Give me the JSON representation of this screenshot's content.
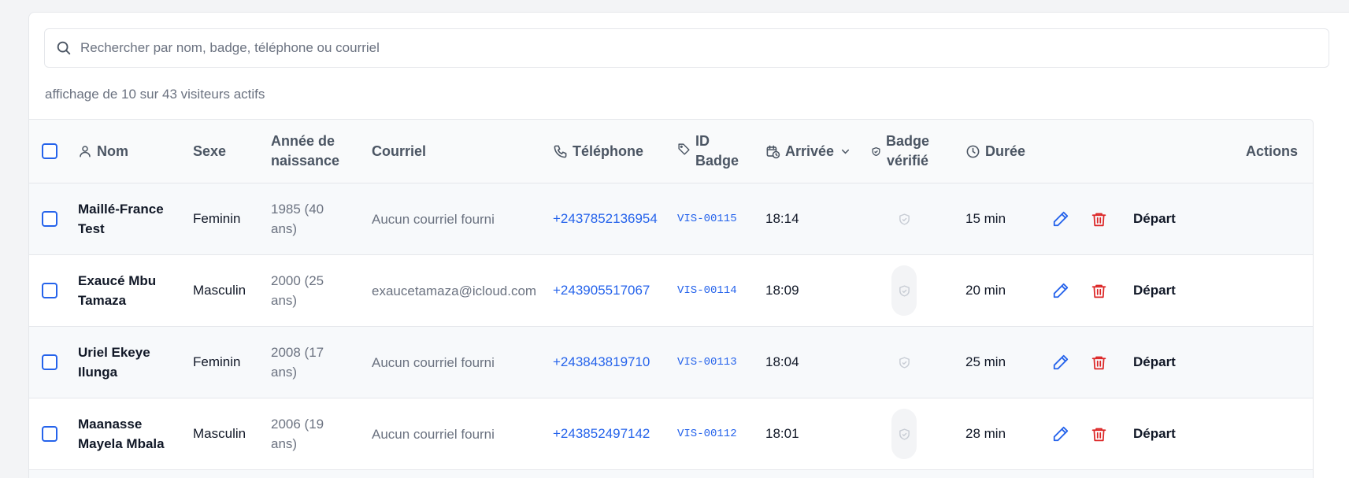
{
  "search": {
    "placeholder": "Rechercher par nom, badge, téléphone ou courriel"
  },
  "summary": "affichage de 10 sur 43 visiteurs actifs",
  "table": {
    "headers": {
      "name": "Nom",
      "sex": "Sexe",
      "birth_line1": "Année de",
      "birth_line2": "naissance",
      "email": "Courriel",
      "phone": "Téléphone",
      "badge_line1": "ID",
      "badge_line2": "Badge",
      "arrival": "Arrivée",
      "verified_line1": "Badge",
      "verified_line2": "vérifié",
      "duration": "Durée",
      "actions": "Actions"
    },
    "rows": [
      {
        "name_line1": "Maillé-France",
        "name_line2": "Test",
        "sex": "Feminin",
        "birth_line1": "1985 (40",
        "birth_line2": "ans)",
        "email": "Aucun courriel fourni",
        "phone": "+2437852136954",
        "badge": "VIS-00115",
        "arrival": "18:14",
        "duration": "15 min",
        "depart": "Départ"
      },
      {
        "name_line1": "Exaucé Mbu",
        "name_line2": "Tamaza",
        "sex": "Masculin",
        "birth_line1": "2000 (25",
        "birth_line2": "ans)",
        "email": "exaucetamaza@icloud.com",
        "phone": "+243905517067",
        "badge": "VIS-00114",
        "arrival": "18:09",
        "duration": "20 min",
        "depart": "Départ"
      },
      {
        "name_line1": "Uriel Ekeye",
        "name_line2": "Ilunga",
        "sex": "Feminin",
        "birth_line1": "2008 (17",
        "birth_line2": "ans)",
        "email": "Aucun courriel fourni",
        "phone": "+243843819710",
        "badge": "VIS-00113",
        "arrival": "18:04",
        "duration": "25 min",
        "depart": "Départ"
      },
      {
        "name_line1": "Maanasse",
        "name_line2": "Mayela Mbala",
        "sex": "Masculin",
        "birth_line1": "2006 (19",
        "birth_line2": "ans)",
        "email": "Aucun courriel fourni",
        "phone": "+243852497142",
        "badge": "VIS-00112",
        "arrival": "18:01",
        "duration": "28 min",
        "depart": "Départ"
      }
    ]
  },
  "colors": {
    "accent": "#2563eb",
    "danger": "#dc2626",
    "muted": "#6b7280"
  },
  "icons": {
    "search": "search-icon",
    "name": "user-icon",
    "phone": "phone-icon",
    "badge": "tag-icon",
    "arrival": "calendar-clock-icon",
    "sort": "chevron-down-icon",
    "verified": "shield-check-icon",
    "duration": "clock-icon",
    "edit": "pencil-icon",
    "delete": "trash-icon"
  }
}
